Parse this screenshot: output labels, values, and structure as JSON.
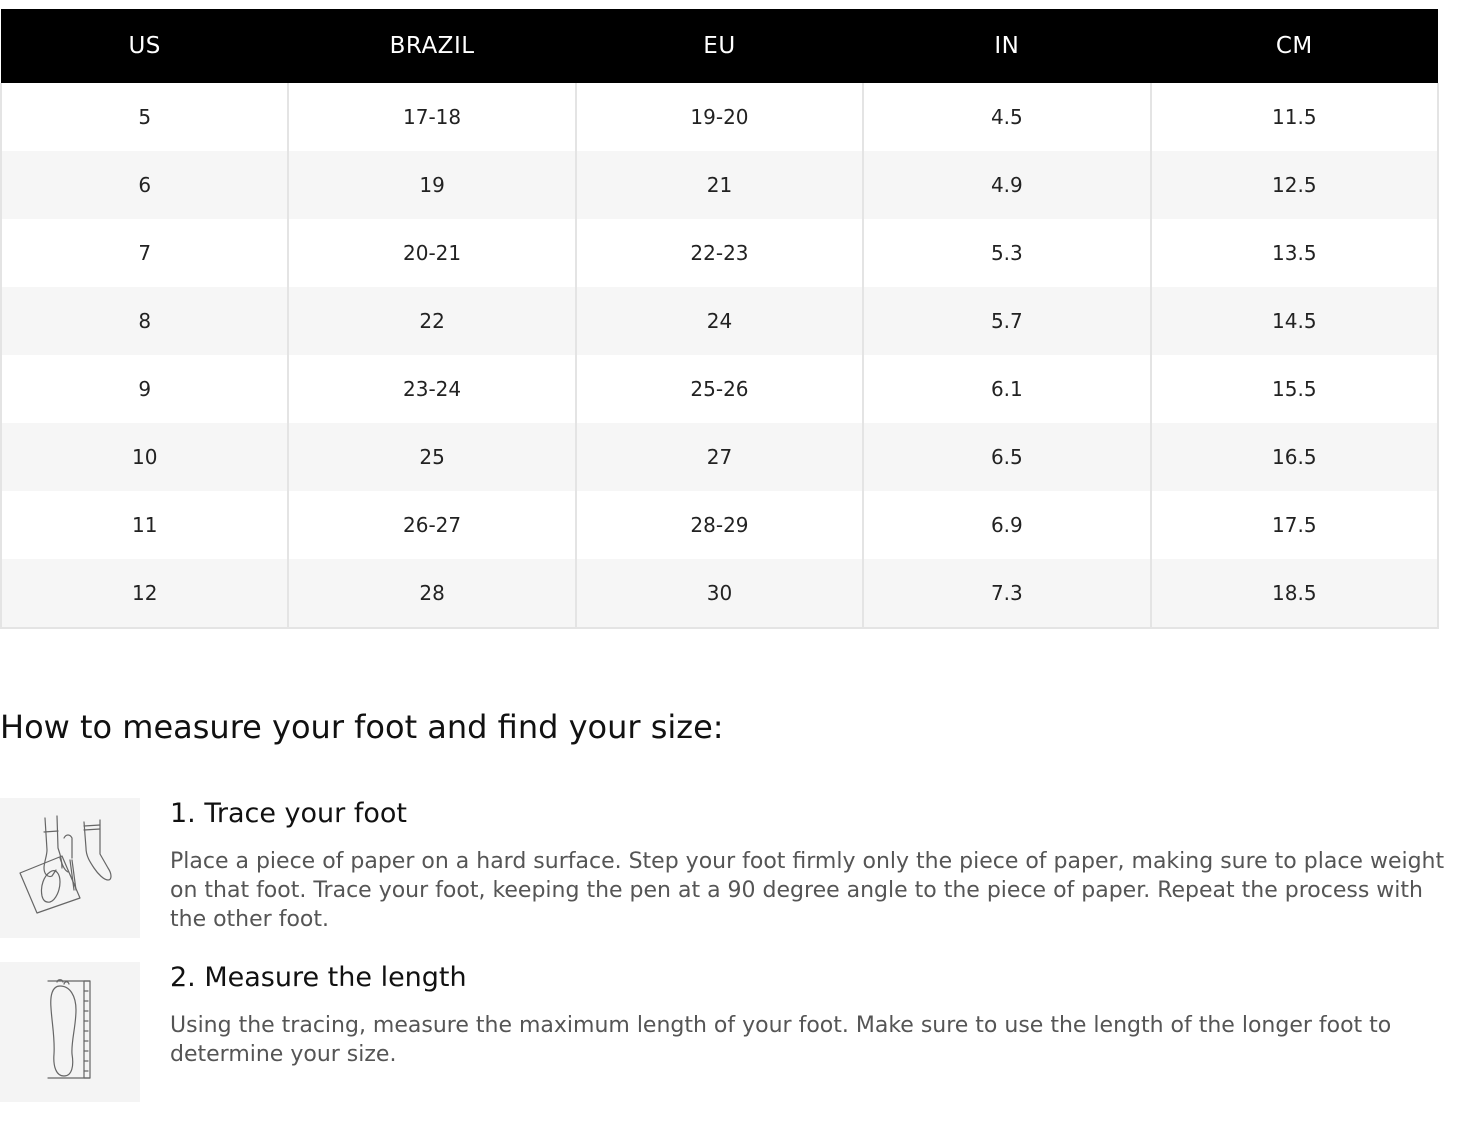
{
  "size_chart": {
    "headers": [
      "US",
      "BRAZIL",
      "EU",
      "IN",
      "CM"
    ],
    "rows": [
      [
        "5",
        "17-18",
        "19-20",
        "4.5",
        "11.5"
      ],
      [
        "6",
        "19",
        "21",
        "4.9",
        "12.5"
      ],
      [
        "7",
        "20-21",
        "22-23",
        "5.3",
        "13.5"
      ],
      [
        "8",
        "22",
        "24",
        "5.7",
        "14.5"
      ],
      [
        "9",
        "23-24",
        "25-26",
        "6.1",
        "15.5"
      ],
      [
        "10",
        "25",
        "27",
        "6.5",
        "16.5"
      ],
      [
        "11",
        "26-27",
        "28-29",
        "6.9",
        "17.5"
      ],
      [
        "12",
        "28",
        "30",
        "7.3",
        "18.5"
      ]
    ]
  },
  "guide": {
    "title": "How to measure your foot and find your size:",
    "steps": [
      {
        "icon": "foot-tracing-icon",
        "heading": "1. Trace your foot",
        "text": "Place a piece of paper on a hard surface. Step your foot firmly only the piece of paper, making sure to place weight on that foot. Trace your foot, keeping the pen at a 90 degree angle to the piece of paper. Repeat the process with the other foot."
      },
      {
        "icon": "foot-ruler-icon",
        "heading": "2. Measure the length",
        "text": "Using the tracing, measure the maximum length of your foot. Make sure to use the length of the longer foot to determine your size."
      }
    ]
  },
  "colors": {
    "header_bg": "#000000",
    "header_text": "#ffffff",
    "row_alt_bg": "#f6f6f6",
    "body_text": "#555555"
  }
}
